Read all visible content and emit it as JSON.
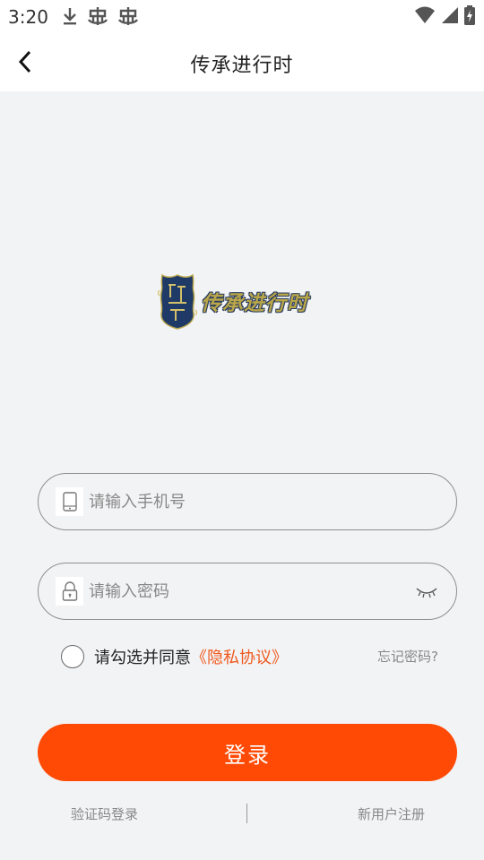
{
  "status_bar": {
    "time": "3:20",
    "left_icons": [
      "download-icon",
      "bug-icon",
      "bug-icon"
    ],
    "right_icons": [
      "wifi-icon",
      "signal-icon",
      "battery-icon"
    ]
  },
  "header": {
    "back_icon": "chevron-left-icon",
    "title": "传承进行时"
  },
  "logo": {
    "text": "传承进行时",
    "colors": {
      "badge": "#1f3a66",
      "gold": "#b9a64a"
    }
  },
  "form": {
    "phone": {
      "placeholder": "请输入手机号",
      "value": "",
      "icon": "phone-icon"
    },
    "password": {
      "placeholder": "请输入密码",
      "value": "",
      "icon": "lock-icon",
      "toggle_icon": "eye-closed-icon"
    },
    "agree": {
      "checked": false,
      "text": "请勾选并同意",
      "link": "《隐私协议》"
    },
    "forgot": "忘记密码?",
    "login_label": "登录"
  },
  "footer": {
    "sms_login": "验证码登录",
    "register": "新用户注册"
  },
  "colors": {
    "accent": "#ff4a05",
    "link": "#f05a1e",
    "background": "#f2f3f5"
  }
}
